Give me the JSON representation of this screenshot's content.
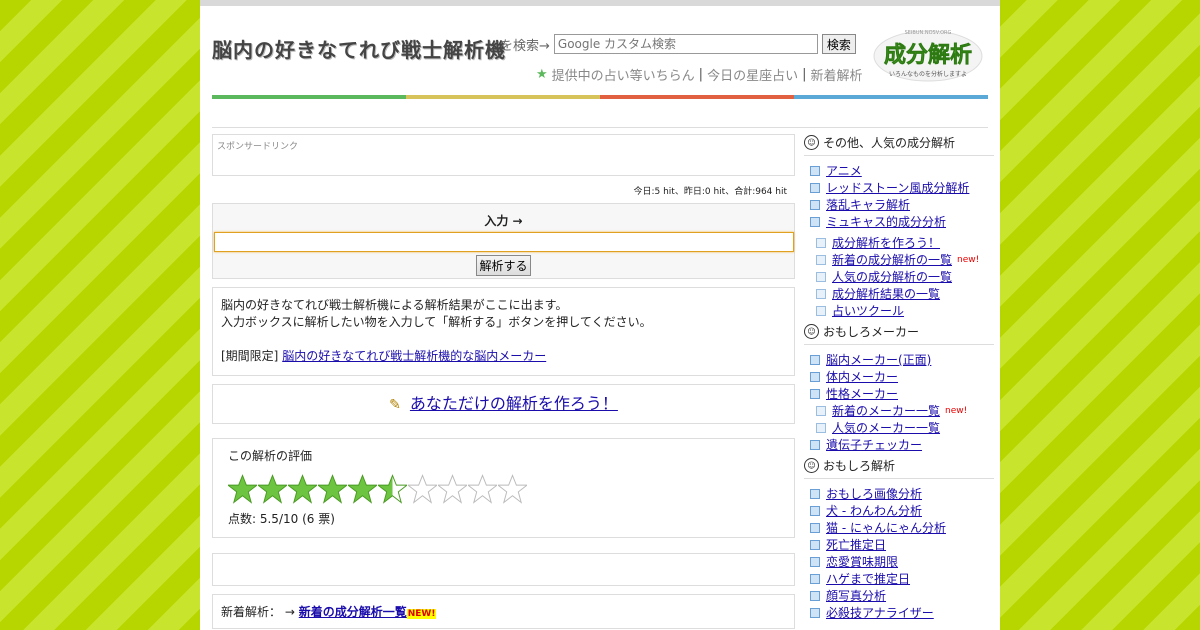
{
  "header": {
    "site_title": "脳内の好きなてれび戦士解析機",
    "search_label": "を検索→",
    "search_placeholder": "Google カスタム検索",
    "search_button": "検索",
    "top_links": [
      "提供中の占い等いちらん",
      "今日の星座占い",
      "新着解析"
    ],
    "logo_main": "成分解析",
    "logo_sub": "いろんなものを分析しますよ",
    "logo_top": "SEIBUN.NOSV.ORG"
  },
  "colors": {
    "bar": [
      "#5cb85c",
      "#d6c45a",
      "#e06040",
      "#5aa9d6"
    ]
  },
  "main": {
    "sponsor_label": "スポンサードリンク",
    "hits": "今日:5 hit、昨日:0 hit、合計:964 hit",
    "input_label": "入力 →",
    "analyze_button": "解析する",
    "desc_line1": "脳内の好きなてれび戦士解析機による解析結果がここに出ます。",
    "desc_line2": "入力ボックスに解析したい物を入力して「解析する」ボタンを押してください。",
    "limited_prefix": "[期間限定]",
    "limited_link": "脳内の好きなてれび戦士解析機的な脳内メーカー",
    "make_own": "あなただけの解析を作ろう！",
    "rating_title": "この解析の評価",
    "rating_value": 5.5,
    "rating_max": 10,
    "score_text": "点数: 5.5/10 (6 票)",
    "new_label": "新着解析：",
    "new_arrow": "→",
    "new_link": "新着の成分解析一覧",
    "new_badge": "NEW!"
  },
  "sidebar": {
    "section1_title": "その他、人気の成分解析",
    "section1_items": [
      "アニメ",
      "レッドストーン風成分解析",
      "落乱キャラ解析",
      "ミュキャス的成分分析"
    ],
    "section1_sub": [
      "成分解析を作ろう！",
      "新着の成分解析の一覧",
      "人気の成分解析の一覧",
      "成分解析結果の一覧",
      "占いツクール"
    ],
    "new_tag": "new!",
    "section2_title": "おもしろメーカー",
    "section2_items": [
      "脳内メーカー(正面)",
      "体内メーカー",
      "性格メーカー"
    ],
    "section2_sub": [
      "新着のメーカー一覧",
      "人気のメーカー一覧"
    ],
    "section2_last": "遺伝子チェッカー",
    "section3_title": "おもしろ解析",
    "section3_items": [
      "おもしろ画像分析",
      "犬 - わんわん分析",
      "猫 - にゃんにゃん分析",
      "死亡推定日",
      "恋愛賞味期限",
      "ハゲまで推定日",
      "顔写真分析",
      "必殺技アナライザー"
    ]
  }
}
